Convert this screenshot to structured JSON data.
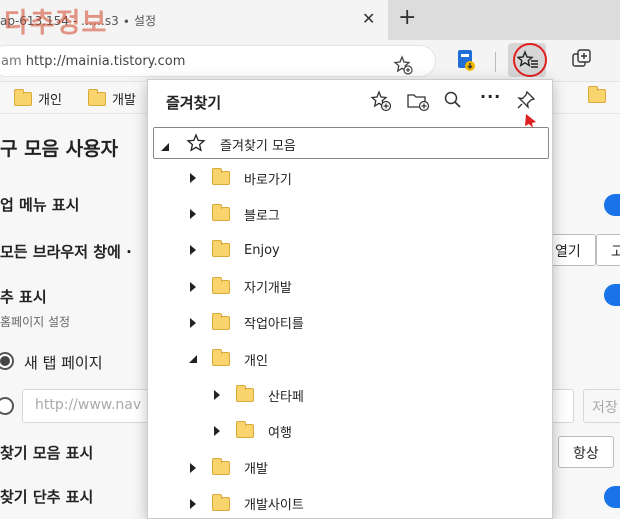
{
  "tab": {
    "title": "ap-613.154  - ……s3 ∙ 설정",
    "close": "✕",
    "new_tab": "+"
  },
  "watermark": "다추정보",
  "address": {
    "prefix": "am",
    "url": "http://mainia.tistory.com"
  },
  "bookmarks_bar": [
    {
      "label": "개인"
    },
    {
      "label": "개발"
    }
  ],
  "settings": {
    "title": "모음 사용자",
    "title_fragment": "구",
    "menu_label": "업 메뉴 표시",
    "all_windows_label": "모든 브라우저 창에 ·",
    "open_button": "열기",
    "other_button": "고",
    "home_label": "추 표시",
    "home_sub": "홈페이지 설정",
    "new_tab_option": "새 탭 페이지",
    "url_placeholder": "http://www.nav",
    "save_button": "저장",
    "fav_bar_label": "찾기 모음 표시",
    "always_button": "항상",
    "fav_button_label": "찾기 단추 표시"
  },
  "favorites_panel": {
    "title": "즐겨찾기",
    "more": "···",
    "root": "즐겨찾기 모음",
    "items": [
      {
        "label": "바로가기",
        "expanded": false,
        "level": 1
      },
      {
        "label": "블로그",
        "expanded": false,
        "level": 1
      },
      {
        "label": "Enjoy",
        "expanded": false,
        "level": 1
      },
      {
        "label": "자기개발",
        "expanded": false,
        "level": 1
      },
      {
        "label": "작업아티를",
        "expanded": false,
        "level": 1
      },
      {
        "label": "개인",
        "expanded": true,
        "level": 1
      },
      {
        "label": "산타페",
        "expanded": false,
        "level": 2
      },
      {
        "label": "여행",
        "expanded": false,
        "level": 2
      },
      {
        "label": "개발",
        "expanded": false,
        "level": 1
      },
      {
        "label": "개발사이트",
        "expanded": false,
        "level": 1
      }
    ]
  },
  "colors": {
    "accent": "#1a73e8",
    "folder": "#f9d36b",
    "highlight": "#e02020"
  }
}
